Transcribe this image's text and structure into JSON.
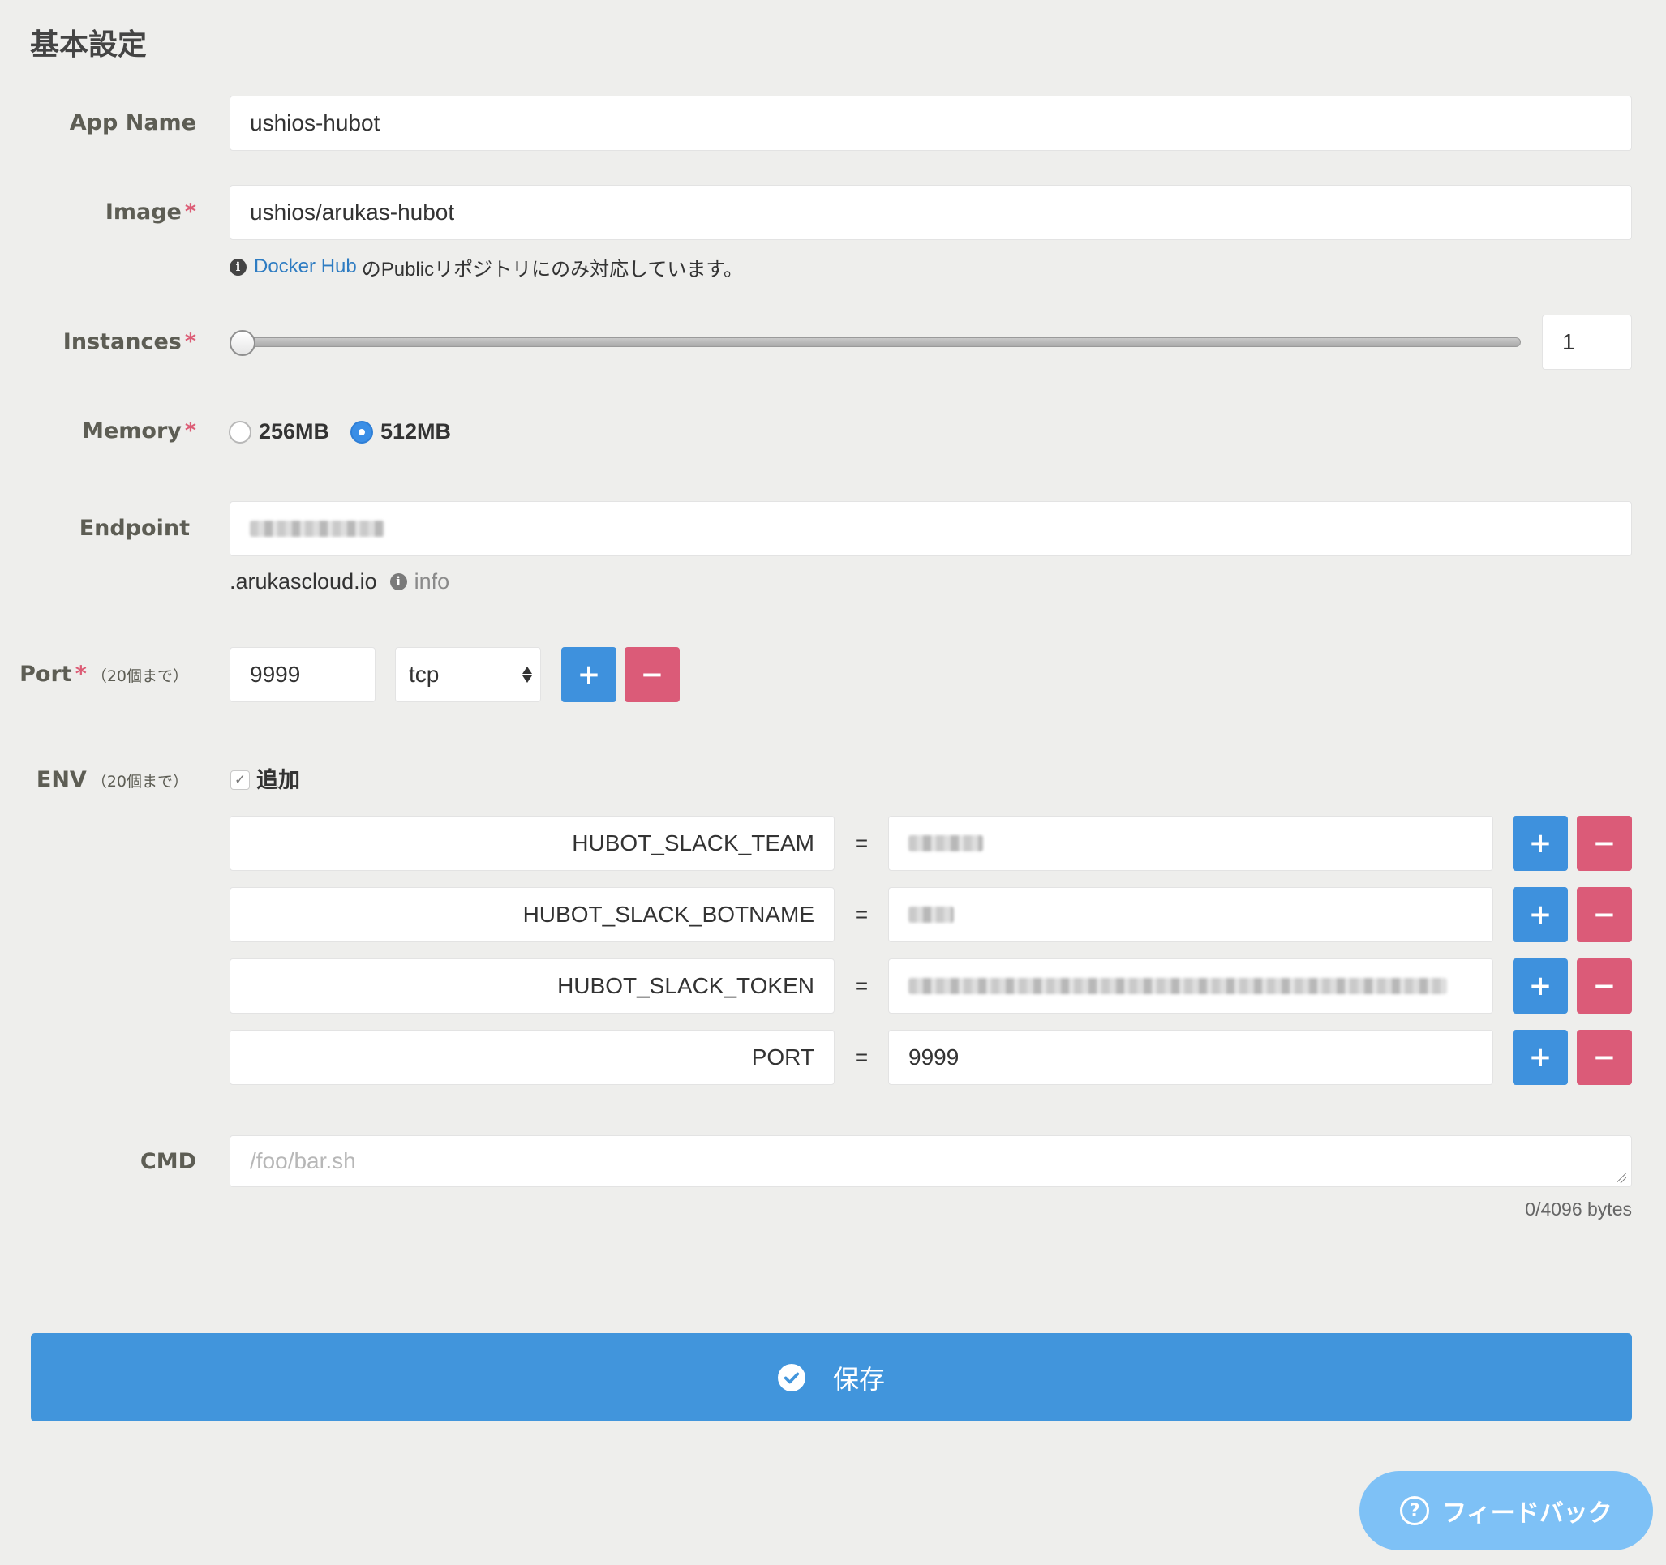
{
  "section_title": "基本設定",
  "app_name": {
    "label": "App Name",
    "value": "ushios-hubot"
  },
  "image": {
    "label": "Image",
    "required_mark": "*",
    "value": "ushios/arukas-hubot",
    "hint_link": "Docker Hub",
    "hint_text": "のPublicリポジトリにのみ対応しています。"
  },
  "instances": {
    "label": "Instances",
    "required_mark": "*",
    "value": "1",
    "slider_fraction": 0.0
  },
  "memory": {
    "label": "Memory",
    "required_mark": "*",
    "options": [
      "256MB",
      "512MB"
    ],
    "selected": "512MB"
  },
  "endpoint": {
    "label": "Endpoint",
    "value_redacted": true,
    "suffix": ".arukascloud.io",
    "info_label": "info"
  },
  "port": {
    "label": "Port",
    "required_mark": "*",
    "limit": "（20個まで）",
    "number": "9999",
    "protocol": "tcp",
    "add_label": "+",
    "remove_label": "−"
  },
  "env": {
    "label": "ENV",
    "limit": "（20個まで）",
    "add_checkbox_label": "追加",
    "add_checked": true,
    "eq": "=",
    "add_label": "+",
    "remove_label": "−",
    "rows": [
      {
        "key": "HUBOT_SLACK_TEAM",
        "value": "",
        "redacted": true
      },
      {
        "key": "HUBOT_SLACK_BOTNAME",
        "value": "",
        "redacted": true
      },
      {
        "key": "HUBOT_SLACK_TOKEN",
        "value": "",
        "redacted": true
      },
      {
        "key": "PORT",
        "value": "9999",
        "redacted": false
      }
    ]
  },
  "cmd": {
    "label": "CMD",
    "placeholder": "/foo/bar.sh",
    "value": "",
    "counter": "0/4096 bytes"
  },
  "save_button": {
    "label": "保存"
  },
  "feedback_button": {
    "label": "フィードバック",
    "icon_glyph": "?"
  },
  "colors": {
    "primary": "#4195dc",
    "danger": "#db5b78",
    "required": "#dc5c75",
    "link": "#2e7cc2",
    "feedback": "#7ec1f6",
    "background": "#eeeeec"
  }
}
